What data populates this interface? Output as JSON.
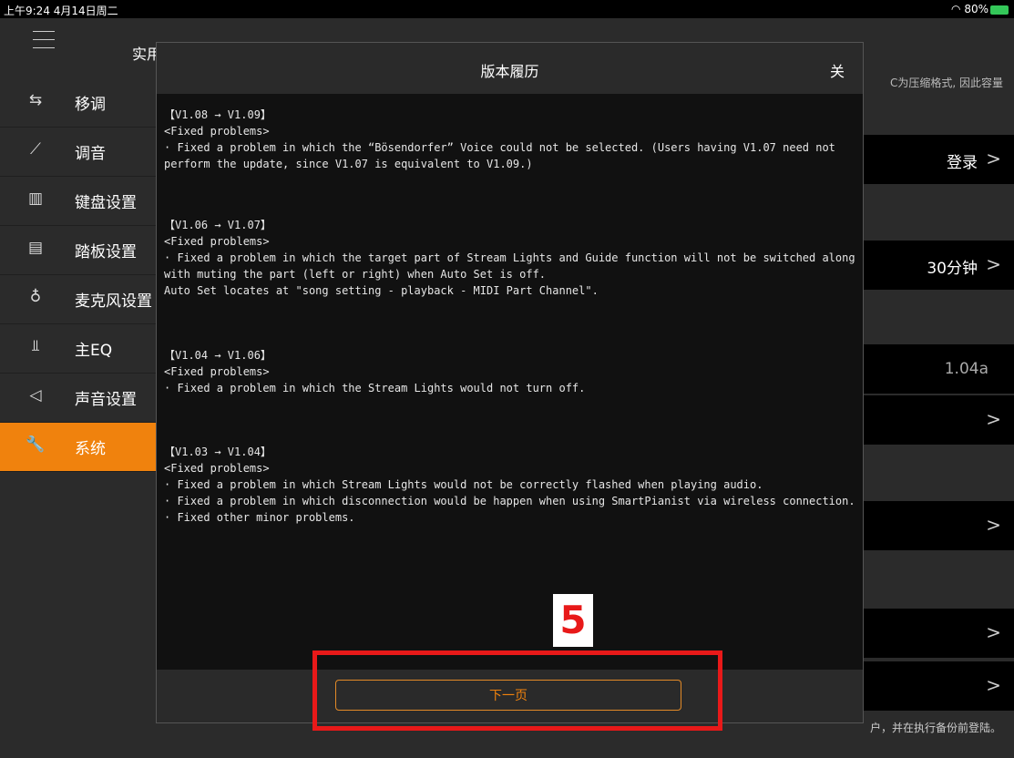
{
  "status_bar": {
    "left": "上午9:24  4月14日周二",
    "right": "80%"
  },
  "sidebar": {
    "title": "实用工",
    "items": [
      {
        "icon": "transpose-icon",
        "glyph": "⇆",
        "label": "移调"
      },
      {
        "icon": "tuning-icon",
        "glyph": "⟋",
        "label": "调音"
      },
      {
        "icon": "keyboard-icon",
        "glyph": "▥",
        "label": "键盘设置"
      },
      {
        "icon": "pedal-icon",
        "glyph": "▤",
        "label": "踏板设置"
      },
      {
        "icon": "microphone-icon",
        "glyph": "♁",
        "label": "麦克风设置"
      },
      {
        "icon": "eq-icon",
        "glyph": "⫫",
        "label": "主EQ"
      },
      {
        "icon": "speaker-icon",
        "glyph": "◁",
        "label": "声音设置"
      },
      {
        "icon": "wrench-icon",
        "glyph": "🔧",
        "label": "系统"
      }
    ]
  },
  "right_pane": {
    "note": "C为压缩格式, 因此容量",
    "login_label": "登录",
    "timeout_value": "30分钟",
    "version": "1.04a",
    "footer": "户，并在执行备份前登陆。"
  },
  "modal": {
    "title": "版本履历",
    "close_label": "关",
    "sections": [
      {
        "header": "【V1.08 → V1.09】",
        "sub": "<Fixed problems>",
        "body": "· Fixed a problem in which the “Bösendorfer” Voice could not be selected. (Users having V1.07 need not perform the update, since V1.07 is equivalent to V1.09.)"
      },
      {
        "header": "【V1.06 → V1.07】",
        "sub": "<Fixed problems>",
        "body": "· Fixed a problem in which the target part of Stream Lights and Guide function will not be switched along with muting the part (left or right) when Auto Set is off.\nAuto Set locates at \"song setting - playback - MIDI Part Channel\"."
      },
      {
        "header": "【V1.04 → V1.06】",
        "sub": "<Fixed problems>",
        "body": "· Fixed a problem in which the Stream Lights would not turn off."
      },
      {
        "header": "【V1.03 → V1.04】",
        "sub": "<Fixed problems>",
        "body": "· Fixed a problem in which Stream Lights would not be correctly flashed when playing audio.\n· Fixed a problem in which disconnection would be happen when using SmartPianist via wireless connection.\n· Fixed other minor problems."
      }
    ],
    "next_button": "下一页"
  },
  "annotation": {
    "label": "5"
  }
}
